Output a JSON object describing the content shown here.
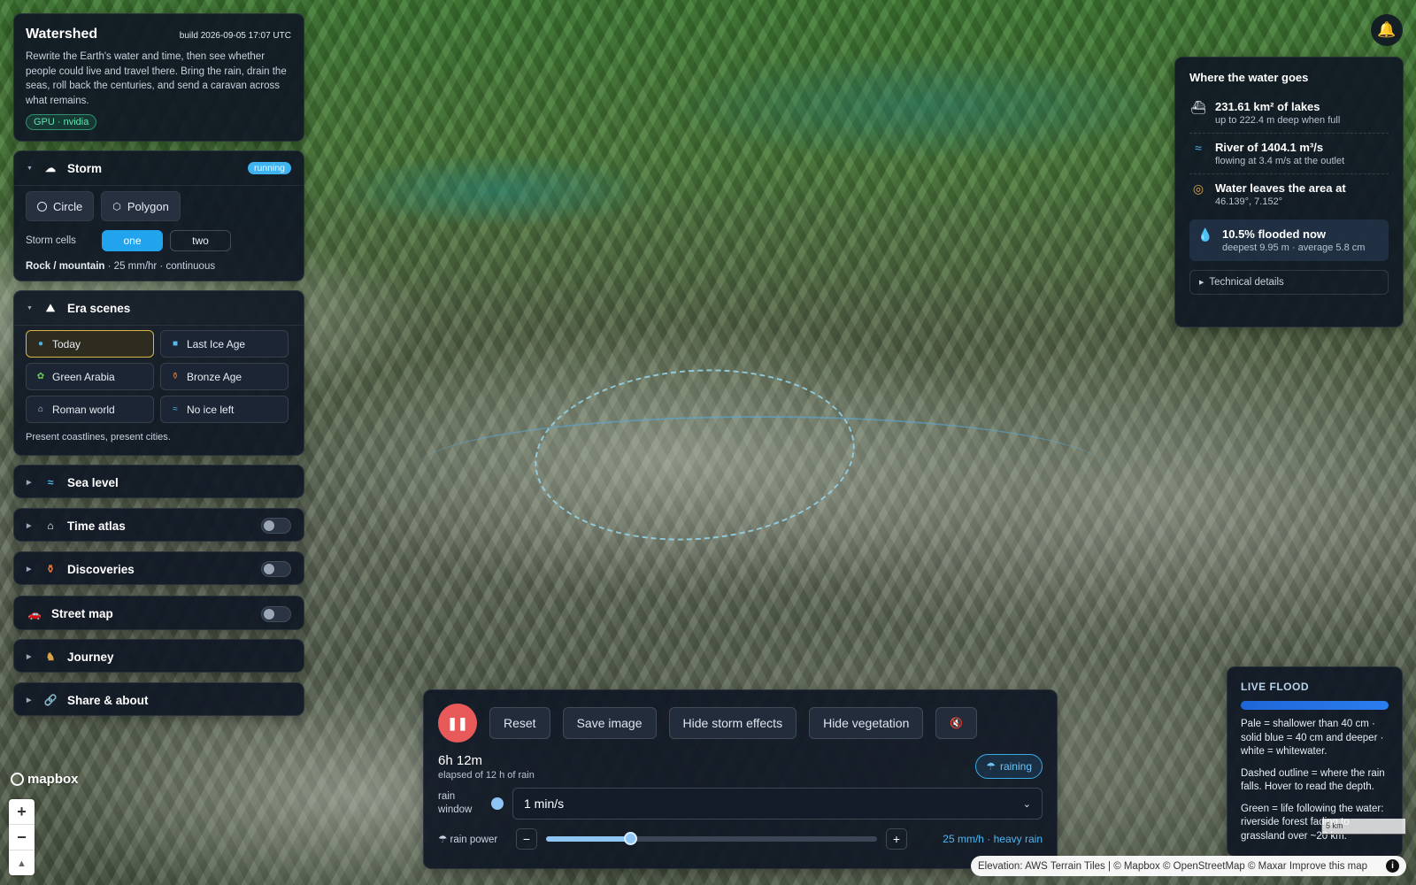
{
  "app": {
    "title": "Watershed",
    "build": "build 2026-09-05 17:07 UTC",
    "description": "Rewrite the Earth's water and time, then see whether people could live and travel there. Bring the rain, drain the seas, roll back the centuries, and send a caravan across what remains.",
    "gpu_badge": "GPU · nvidia"
  },
  "storm": {
    "title": "Storm",
    "status": "running",
    "shape_buttons": [
      "Circle",
      "Polygon"
    ],
    "cells_label": "Storm cells",
    "cells_options": [
      "one",
      "two"
    ],
    "cells_selected": "one",
    "terrain": "Rock / mountain",
    "terrain_detail": " · 25 mm/hr · continuous"
  },
  "era": {
    "title": "Era scenes",
    "scenes": [
      {
        "label": "Today",
        "icon": "globe-icon",
        "active": true
      },
      {
        "label": "Last Ice Age",
        "icon": "ice-cube-icon",
        "active": false
      },
      {
        "label": "Green Arabia",
        "icon": "plant-icon",
        "active": false
      },
      {
        "label": "Bronze Age",
        "icon": "amphora-icon",
        "active": false
      },
      {
        "label": "Roman world",
        "icon": "temple-icon",
        "active": false
      },
      {
        "label": "No ice left",
        "icon": "wave-icon",
        "active": false
      }
    ],
    "note": "Present coastlines, present cities."
  },
  "sections": {
    "sea_level": "Sea level",
    "time_atlas": "Time atlas",
    "discoveries": "Discoveries",
    "street_map": "Street map",
    "journey": "Journey",
    "share": "Share & about"
  },
  "water": {
    "title": "Where the water goes",
    "lakes_main": "231.61 km² of lakes",
    "lakes_sub": "up to 222.4 m deep when full",
    "river_main": "River of 1404.1 m³/s",
    "river_sub": "flowing at 3.4 m/s at the outlet",
    "outlet_main": "Water leaves the area at",
    "outlet_sub": "46.139°, 7.152°",
    "flood_main": "10.5% flooded now",
    "flood_sub": "deepest 9.95 m · average 5.8 cm",
    "technical": "Technical details"
  },
  "controls": {
    "reset": "Reset",
    "save": "Save image",
    "hide_storm": "Hide storm effects",
    "hide_veg": "Hide vegetation",
    "elapsed": "6h 12m",
    "elapsed_sub": "elapsed of 12 h of rain",
    "raining": "raining",
    "rain_window_label": "rain window",
    "rain_window_value": "1 min/s",
    "rain_power_label": "rain power",
    "rain_power_value": "25 mm/h · heavy rain",
    "rain_power_fraction": 0.255
  },
  "live_flood": {
    "title": "LIVE FLOOD",
    "p1": "Pale = shallower than 40 cm · solid blue = 40 cm and deeper · white = whitewater.",
    "p2": "Dashed outline = where the rain falls. Hover to read the depth.",
    "p3": "Green = life following the water: riverside forest fading to grassland over ~20 km."
  },
  "map": {
    "logo": "mapbox",
    "scale": "5 km",
    "attribution": "Elevation: AWS Terrain Tiles | © Mapbox © OpenStreetMap © Maxar Improve this map"
  },
  "colors": {
    "accent": "#22a3ee",
    "pause": "#e85a5a",
    "active_era": "#d9b64a",
    "gpu": "#5fe3b0"
  }
}
